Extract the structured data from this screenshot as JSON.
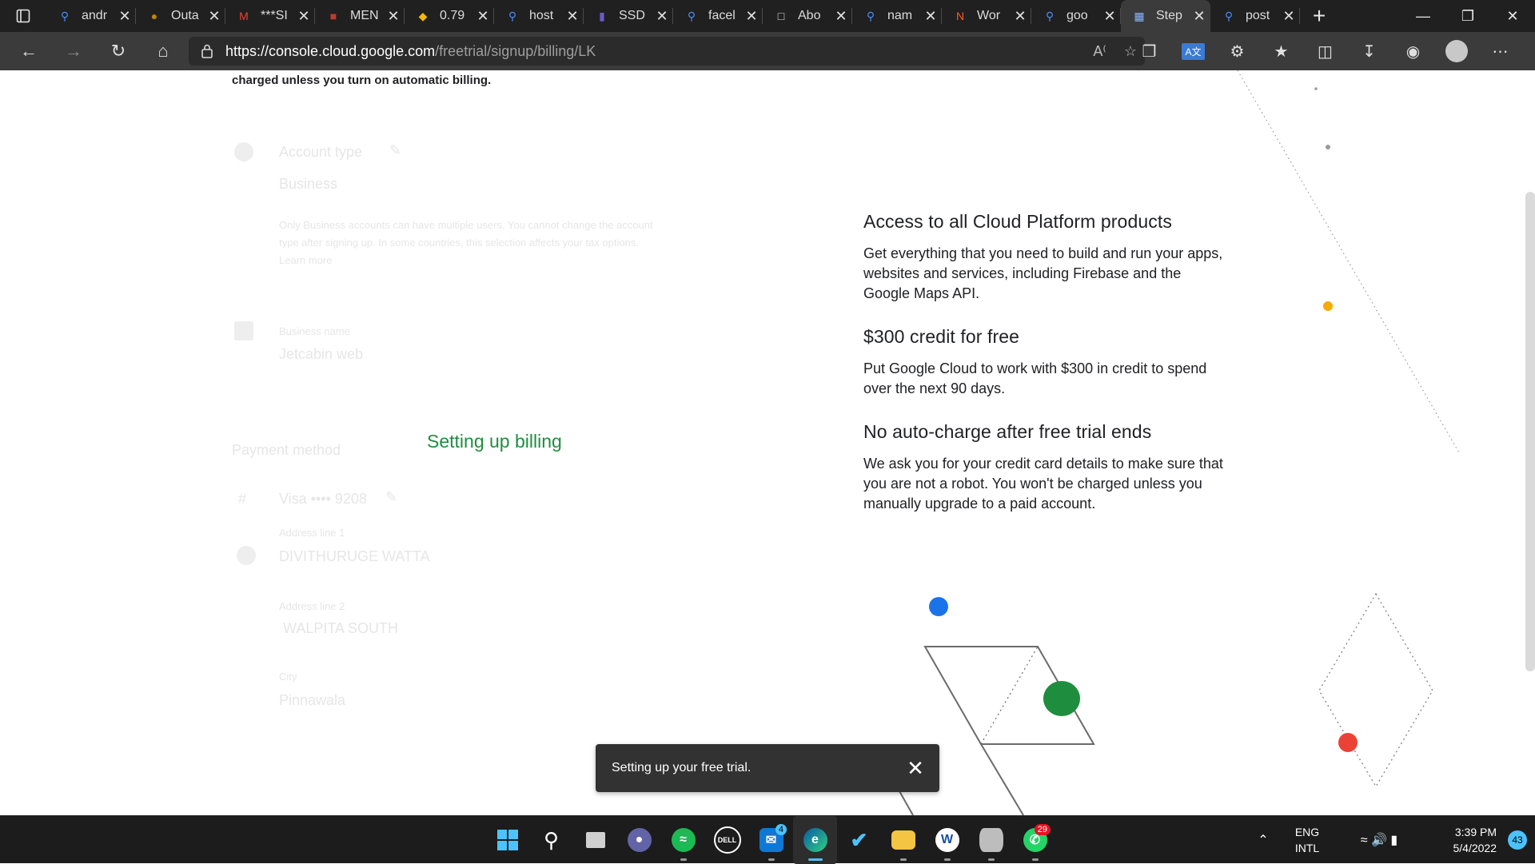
{
  "browser": {
    "tabs": [
      {
        "icon": "search-icon",
        "title": "andr"
      },
      {
        "icon": "owl-icon",
        "title": "Outa"
      },
      {
        "icon": "gmail-icon",
        "title": "***SI"
      },
      {
        "icon": "bank-icon",
        "title": "MEN"
      },
      {
        "icon": "binance-icon",
        "title": "0.79"
      },
      {
        "icon": "search-icon",
        "title": "host"
      },
      {
        "icon": "bookmark-icon",
        "title": "SSD"
      },
      {
        "icon": "search-icon",
        "title": "facel"
      },
      {
        "icon": "page-icon",
        "title": "Abo"
      },
      {
        "icon": "search-icon",
        "title": "nam"
      },
      {
        "icon": "wordart-icon",
        "title": "Wor"
      },
      {
        "icon": "search-icon",
        "title": "goo"
      },
      {
        "icon": "gift-icon",
        "title": "Step",
        "active": true
      },
      {
        "icon": "search-icon",
        "title": "post"
      }
    ],
    "url_host": "https://console.cloud.google.com",
    "url_path": "/freetrial/signup/billing/LK"
  },
  "page": {
    "top_text": "charged unless you turn on automatic billing.",
    "account_type_label": "Account type",
    "account_type_value": "Business",
    "account_help_1": "Only Business accounts can have multiple users. You cannot change the account",
    "account_help_2": "type after signing up. In some countries, this selection affects your tax options.",
    "learn_more": "Learn more",
    "business_name_label": "Business name",
    "business_name_value": "Jetcabin web",
    "payment_method_label": "Payment method",
    "card_value": "Visa •••• 9208",
    "address_label": "Address line 1",
    "address_value": "DIVITHURUGE WATTA",
    "address2_label": "Address line 2",
    "address2_value": "WALPITA SOUTH",
    "city_label": "City",
    "city_value": "Pinnawala",
    "setting_up": "Setting up billing",
    "features": [
      {
        "title": "Access to all Cloud Platform products",
        "body": "Get everything that you need to build and run your apps, websites and services, including Firebase and the Google Maps API."
      },
      {
        "title": "$300 credit for free",
        "body": "Put Google Cloud to work with $300 in credit to spend over the next 90 days."
      },
      {
        "title": "No auto-charge after free trial ends",
        "body": "We ask you for your credit card details to make sure that you are not a robot. You won't be charged unless you manually upgrade to a paid account."
      }
    ],
    "toast": "Setting up your free trial."
  },
  "taskbar": {
    "mail_badge": "4",
    "whatsapp_badge": "29",
    "lang_1": "ENG",
    "lang_2": "INTL",
    "time": "3:39 PM",
    "date": "5/4/2022",
    "notifications": "43"
  },
  "colors": {
    "accent_green": "#1e8e3e",
    "toast_bg": "#323232",
    "taskbar_bg": "#1c1c1c"
  }
}
